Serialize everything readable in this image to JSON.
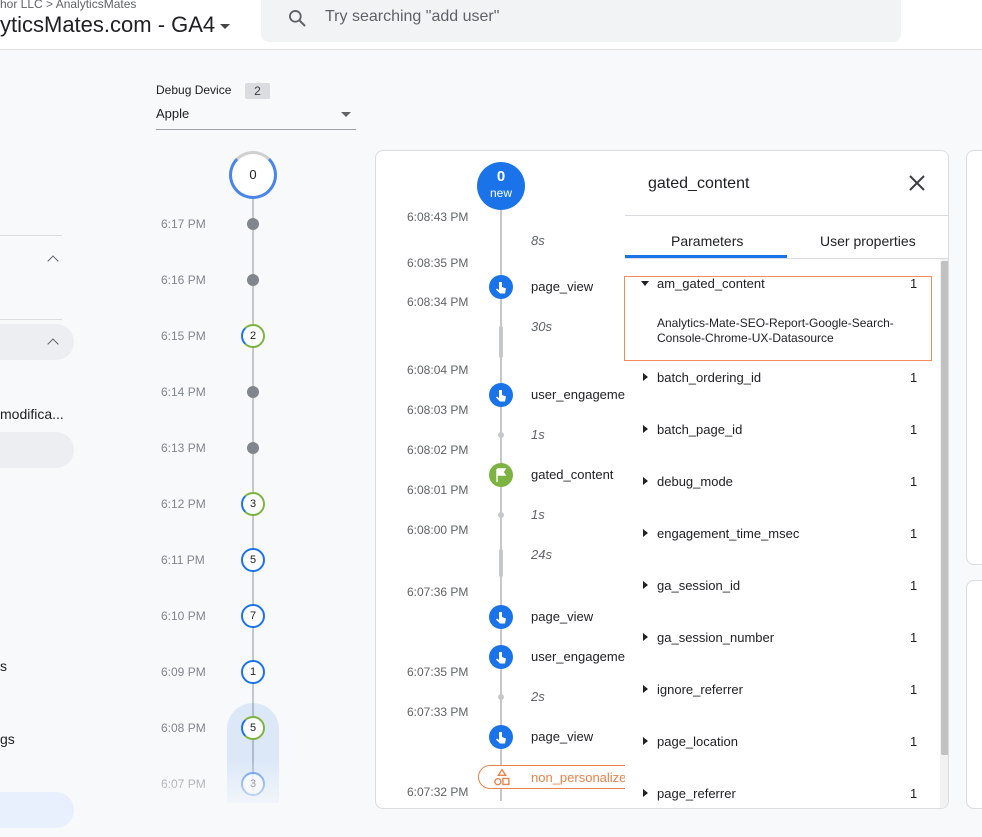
{
  "header": {
    "breadcrumb": "hor LLC > AnalyticsMates",
    "property_title": "yticsMates.com - GA4",
    "search_placeholder": "Try searching \"add user\""
  },
  "sidebar": {
    "truncated_item_1": "modifica...",
    "truncated_item_2": "s",
    "truncated_item_3": "gs"
  },
  "debug_device": {
    "label": "Debug Device",
    "count": "2",
    "selected": "Apple"
  },
  "minutes": {
    "top_count": "0",
    "rows": [
      {
        "time": "6:17 PM",
        "count": null
      },
      {
        "time": "6:16 PM",
        "count": null
      },
      {
        "time": "6:15 PM",
        "count": "2"
      },
      {
        "time": "6:14 PM",
        "count": null
      },
      {
        "time": "6:13 PM",
        "count": null
      },
      {
        "time": "6:12 PM",
        "count": "3"
      },
      {
        "time": "6:11 PM",
        "count": "5"
      },
      {
        "time": "6:10 PM",
        "count": "7"
      },
      {
        "time": "6:09 PM",
        "count": "1"
      },
      {
        "time": "6:08 PM",
        "count": "5"
      },
      {
        "time": "6:07 PM",
        "count": "3"
      }
    ]
  },
  "events": {
    "new_count": "0",
    "new_label": "new",
    "times": [
      "6:08:43 PM",
      "6:08:35 PM",
      "6:08:34 PM",
      "6:08:04 PM",
      "6:08:03 PM",
      "6:08:02 PM",
      "6:08:01 PM",
      "6:08:00 PM",
      "6:07:36 PM",
      "6:07:35 PM",
      "6:07:33 PM",
      "6:07:32 PM"
    ],
    "gaps": [
      "8s",
      "30s",
      "1s",
      "1s",
      "24s",
      "2s"
    ],
    "names": [
      "page_view",
      "user_engagemer",
      "gated_content",
      "page_view",
      "user_engagemer",
      "page_view"
    ],
    "warning": "non_personalize"
  },
  "detail": {
    "title": "gated_content",
    "tabs": [
      "Parameters",
      "User properties"
    ],
    "expanded_value": "Analytics-Mate-SEO-Report-Google-Search-Console-Chrome-UX-Datasource",
    "params": [
      {
        "name": "am_gated_content",
        "count": "1"
      },
      {
        "name": "batch_ordering_id",
        "count": "1"
      },
      {
        "name": "batch_page_id",
        "count": "1"
      },
      {
        "name": "debug_mode",
        "count": "1"
      },
      {
        "name": "engagement_time_msec",
        "count": "1"
      },
      {
        "name": "ga_session_id",
        "count": "1"
      },
      {
        "name": "ga_session_number",
        "count": "1"
      },
      {
        "name": "ignore_referrer",
        "count": "1"
      },
      {
        "name": "page_location",
        "count": "1"
      },
      {
        "name": "page_referrer",
        "count": "1"
      }
    ]
  },
  "colors": {
    "accent": "#1a73e8",
    "conversion_flag": "#7cb342",
    "highlight_border": "#f28b5b",
    "warning": "#e8834b"
  }
}
